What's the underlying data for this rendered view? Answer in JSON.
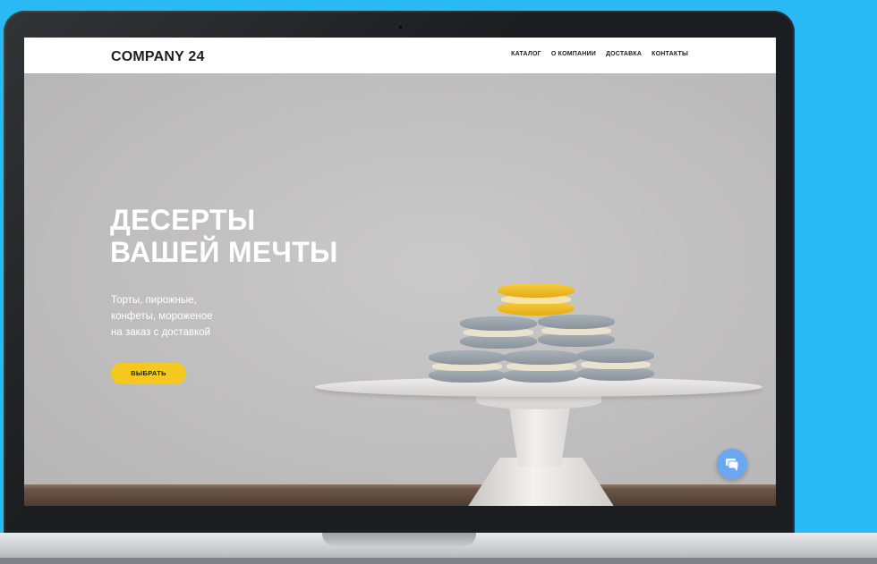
{
  "site": {
    "logo": "COMPANY 24",
    "nav": [
      "КАТАЛОГ",
      "О КОМПАНИИ",
      "ДОСТАВКА",
      "КОНТАКТЫ"
    ]
  },
  "hero": {
    "title_line1": "ДЕСЕРТЫ",
    "title_line2": "ВАШЕЙ МЕЧТЫ",
    "subtitle_line1": "Торты, пирожные,",
    "subtitle_line2": "конфеты, мороженое",
    "subtitle_line3": "на заказ с доставкой",
    "cta_label": "ВЫБРАТЬ"
  },
  "widgets": {
    "chat_icon": "chat-bubble-icon"
  },
  "colors": {
    "background": "#29b9f5",
    "accent": "#f4c81d",
    "chat": "#6aa8f0"
  }
}
